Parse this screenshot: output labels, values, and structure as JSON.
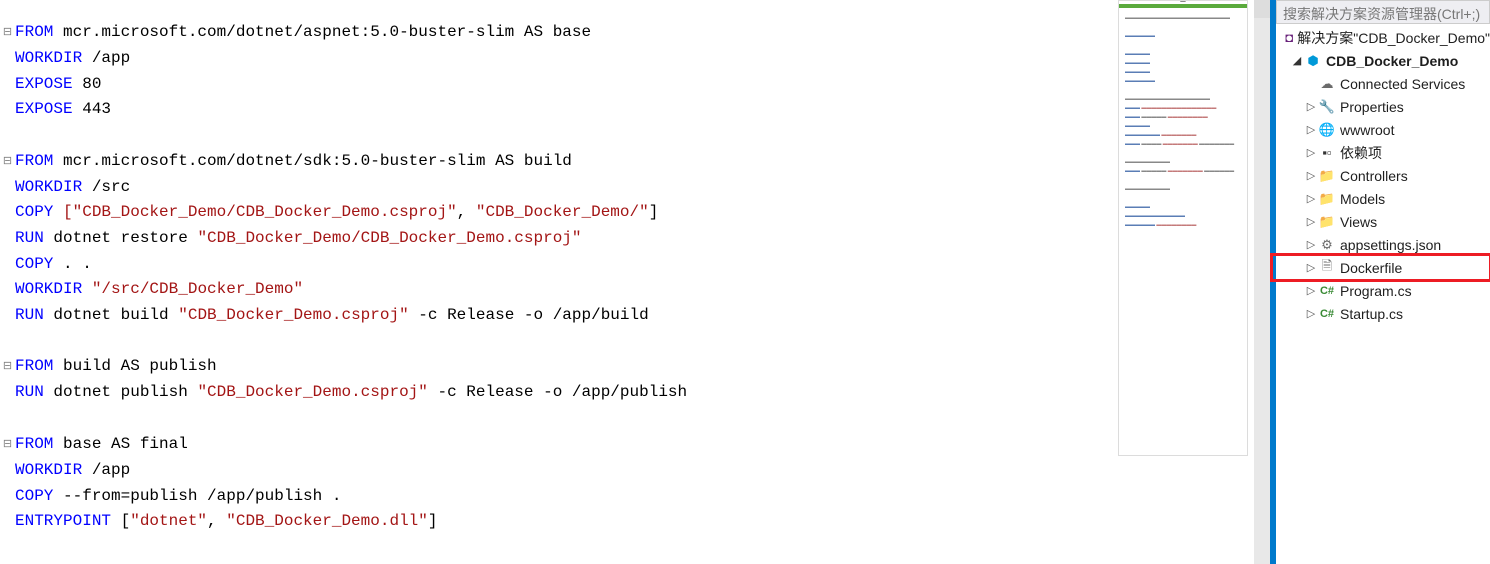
{
  "code": {
    "l1": {
      "kw": "FROM",
      "rest": " mcr.microsoft.com/dotnet/aspnet:5.0-buster-slim AS base"
    },
    "l2": {
      "kw": "WORKDIR",
      "rest": " /app"
    },
    "l3": {
      "kw": "EXPOSE",
      "rest": " 80"
    },
    "l4": {
      "kw": "EXPOSE",
      "rest": " 443"
    },
    "l5": {
      "kw": "FROM",
      "rest": " mcr.microsoft.com/dotnet/sdk:5.0-buster-slim AS build"
    },
    "l6": {
      "kw": "WORKDIR",
      "rest": " /src"
    },
    "l7": {
      "kw": "COPY",
      "s1": " [\"CDB_Docker_Demo/CDB_Docker_Demo.csproj\"",
      "mid": ", ",
      "s2": "\"CDB_Docker_Demo/\"",
      "end": "]"
    },
    "l8": {
      "kw": "RUN",
      "t1": " dotnet restore ",
      "s1": "\"CDB_Docker_Demo/CDB_Docker_Demo.csproj\""
    },
    "l9": {
      "kw": "COPY",
      "rest": " . ."
    },
    "l10": {
      "kw": "WORKDIR",
      "s1": " \"/src/CDB_Docker_Demo\""
    },
    "l11": {
      "kw": "RUN",
      "t1": " dotnet build ",
      "s1": "\"CDB_Docker_Demo.csproj\"",
      "t2": " -c Release -o /app/build"
    },
    "l12": {
      "kw": "FROM",
      "rest": " build AS publish"
    },
    "l13": {
      "kw": "RUN",
      "t1": " dotnet publish ",
      "s1": "\"CDB_Docker_Demo.csproj\"",
      "t2": " -c Release -o /app/publish"
    },
    "l14": {
      "kw": "FROM",
      "rest": " base AS final"
    },
    "l15": {
      "kw": "WORKDIR",
      "rest": " /app"
    },
    "l16": {
      "kw": "COPY",
      "rest": " --from=publish /app/publish ."
    },
    "l17": {
      "kw": "ENTRYPOINT",
      "t1": " [",
      "s1": "\"dotnet\"",
      "mid": ", ",
      "s2": "\"CDB_Docker_Demo.dll\"",
      "t2": "]"
    }
  },
  "search_placeholder": "搜索解决方案资源管理器(Ctrl+;)",
  "tree": {
    "solution": "解决方案\"CDB_Docker_Demo\"",
    "project": "CDB_Docker_Demo",
    "connected": "Connected Services",
    "properties": "Properties",
    "wwwroot": "wwwroot",
    "deps": "依赖项",
    "controllers": "Controllers",
    "models": "Models",
    "views": "Views",
    "appsettings": "appsettings.json",
    "dockerfile": "Dockerfile",
    "program": "Program.cs",
    "startup": "Startup.cs"
  },
  "icons": {
    "sln": "◘",
    "proj": "⬢",
    "conn": "☁",
    "prop": "🔧",
    "www": "🌐",
    "dep": "▪▫",
    "fold": "📁",
    "json": "⚙",
    "file": "🗎",
    "cs": "C#"
  }
}
